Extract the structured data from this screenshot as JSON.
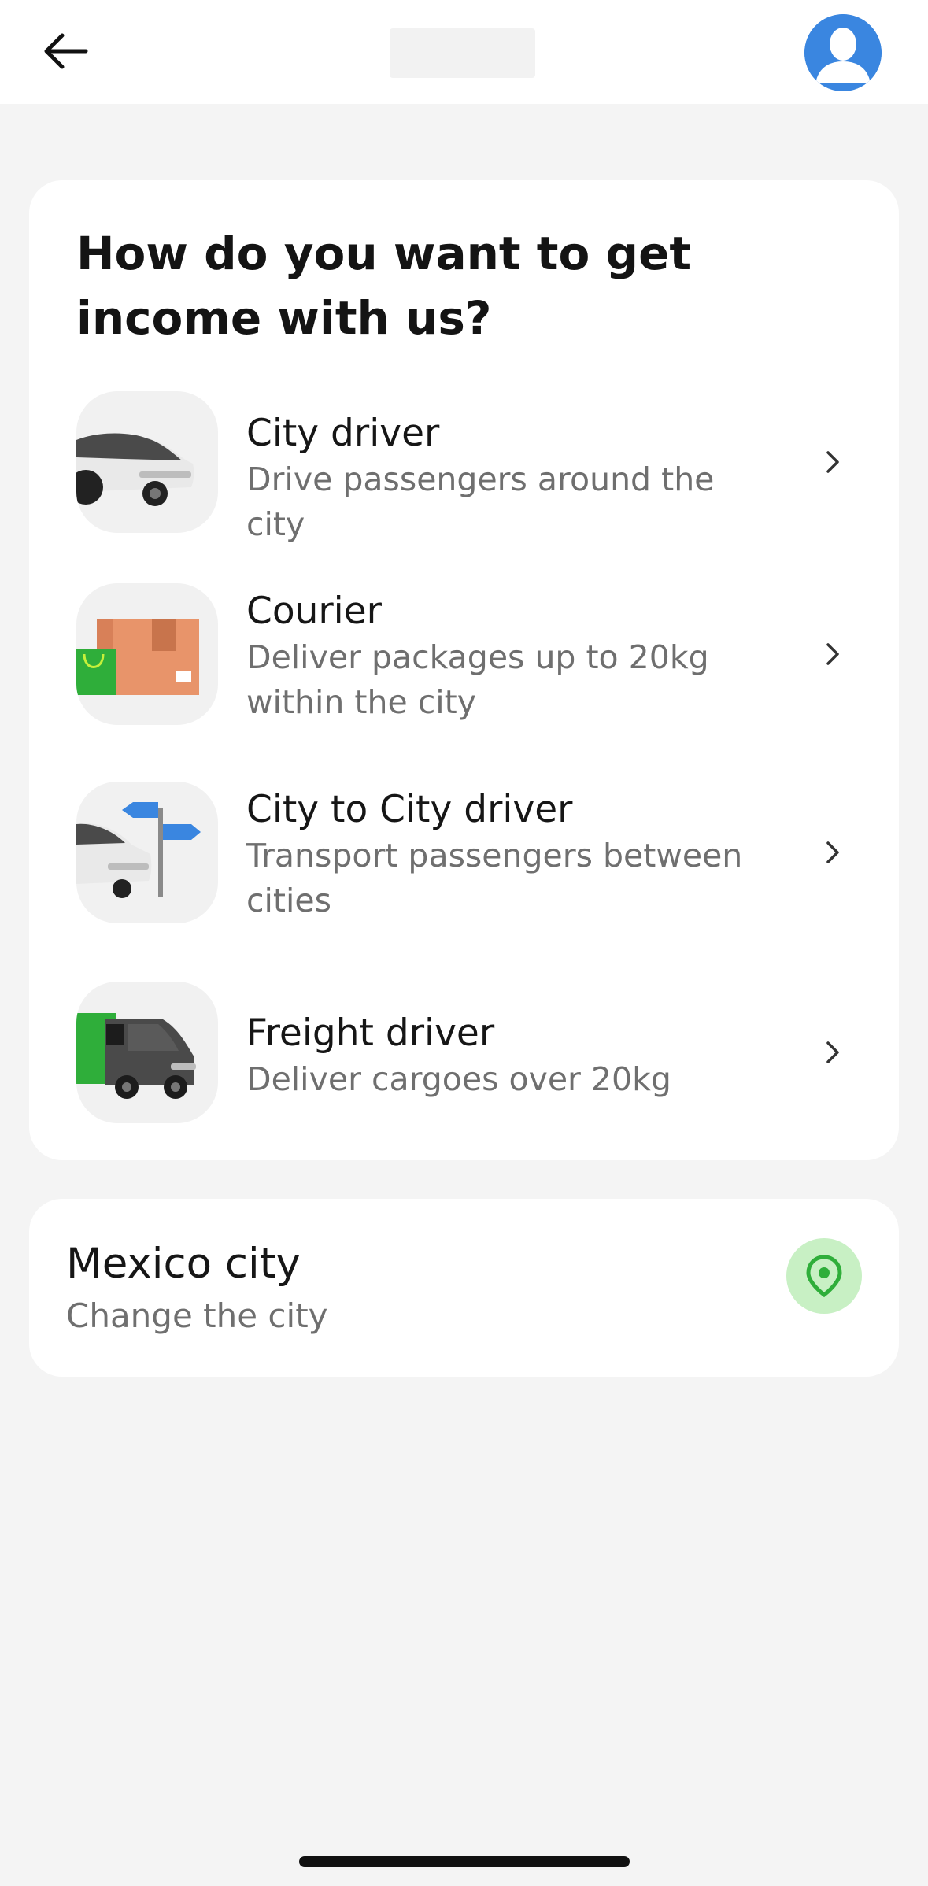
{
  "header": {
    "back_icon": "arrow-left-icon",
    "avatar_icon": "user-avatar-icon",
    "accent": "#3a86e0"
  },
  "main": {
    "heading": "How do you want to get income with us?",
    "options": [
      {
        "title": "City driver",
        "description": "Drive passengers around the city",
        "icon": "car-icon"
      },
      {
        "title": "Courier",
        "description": "Deliver packages up to 20kg within the city",
        "icon": "package-icon"
      },
      {
        "title": "City to City driver",
        "description": "Transport passengers between cities",
        "icon": "car-signpost-icon"
      },
      {
        "title": "Freight driver",
        "description": "Deliver cargoes over 20kg",
        "icon": "truck-icon"
      }
    ]
  },
  "city": {
    "name": "Mexico city",
    "action": "Change the city",
    "icon": "location-pin-icon",
    "pin_color": "#2fae3a"
  }
}
